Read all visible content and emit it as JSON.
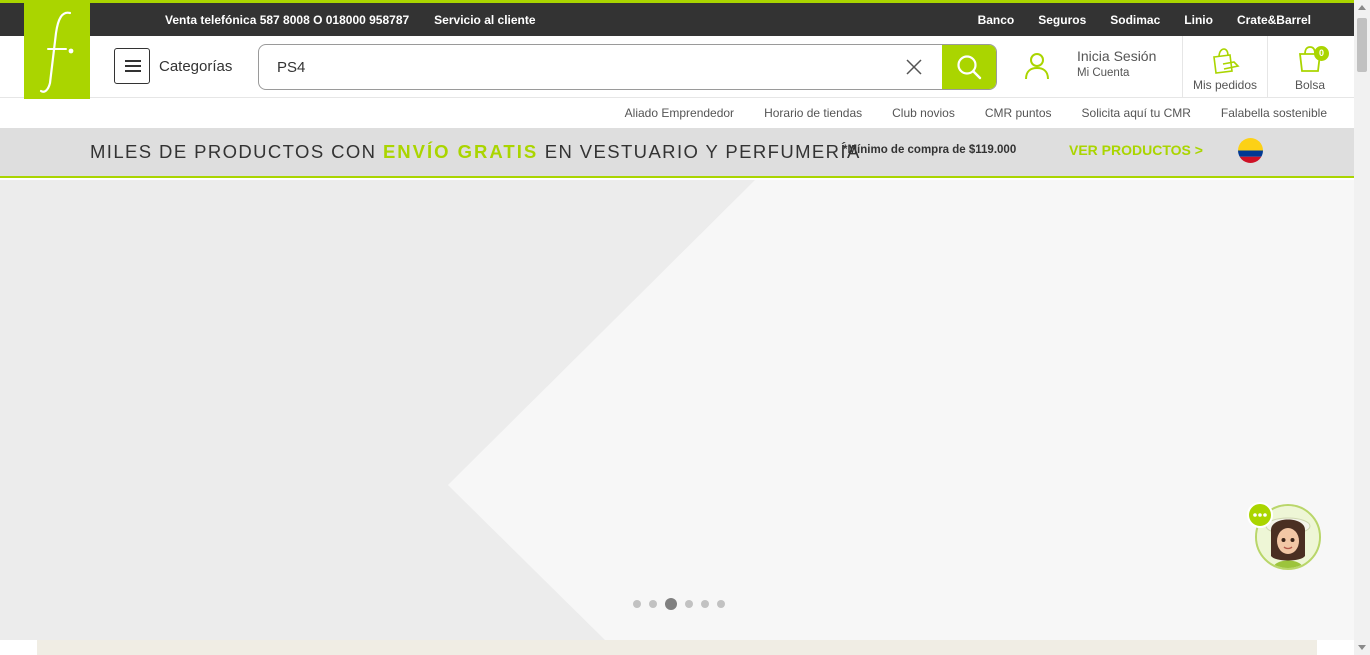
{
  "colors": {
    "brand_green": "#aad500",
    "top_bar": "#333333",
    "promo_bg": "#dedede"
  },
  "topbar": {
    "phone_text": "Venta telefónica 587 8008 O 018000 958787",
    "customer_service": "Servicio al cliente",
    "links": [
      "Banco",
      "Seguros",
      "Sodimac",
      "Linio",
      "Crate&Barrel"
    ]
  },
  "logo": {
    "icon": "falabella-f-logo-icon"
  },
  "header": {
    "categories_label": "Categorías",
    "search": {
      "value": "PS4",
      "placeholder": ""
    },
    "login_title": "Inicia Sesión",
    "login_subtitle": "Mi Cuenta",
    "orders_label": "Mis pedidos",
    "bag_label": "Bolsa",
    "bag_count": "0"
  },
  "sublinks": [
    "Aliado Emprendedor",
    "Horario de tiendas",
    "Club novios",
    "CMR puntos",
    "Solicita aquí tu CMR",
    "Falabella sostenible"
  ],
  "promo": {
    "text_before": "MILES DE PRODUCTOS CON ",
    "highlight": "ENVÍO GRATIS",
    "text_after": " EN VESTUARIO Y PERFUMERÍA",
    "minimum": "*Mínimo de compra de $119.000",
    "cta": "VER PRODUCTOS >",
    "flag_icon": "colombia-flag-icon"
  },
  "carousel": {
    "total_slides": 6,
    "active_slide": 3
  },
  "chat": {
    "icon": "chat-assistant-avatar-icon"
  }
}
